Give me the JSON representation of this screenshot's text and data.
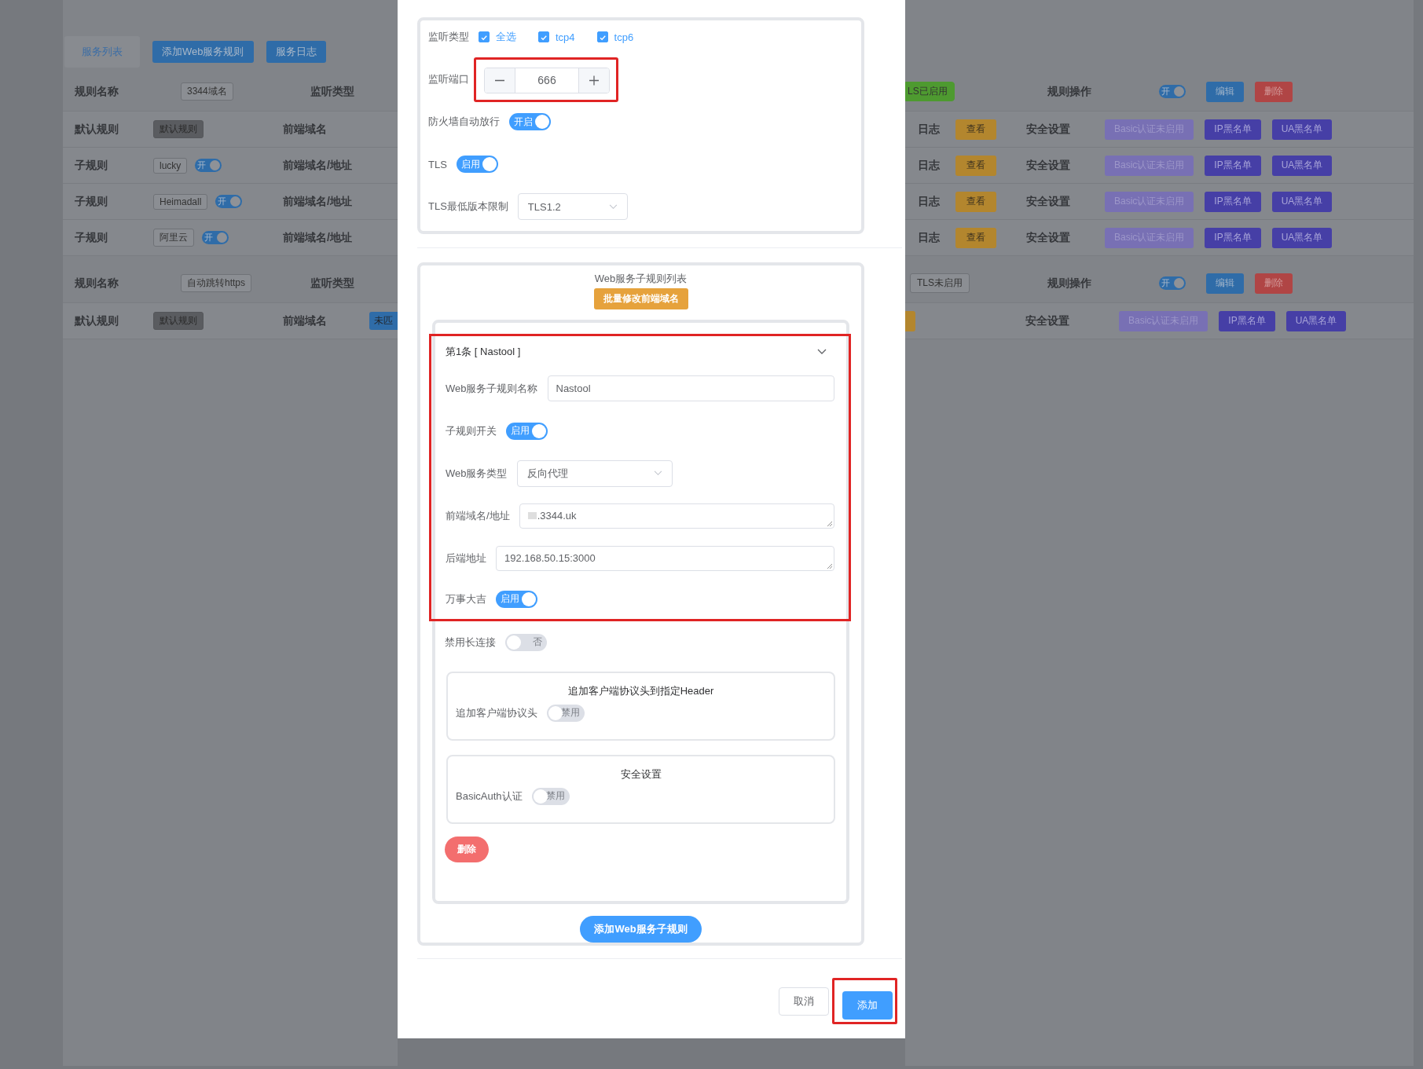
{
  "background": {
    "tabs": [
      {
        "label": "服务列表",
        "selected": true
      },
      {
        "label": "添加Web服务规则",
        "selected": false
      },
      {
        "label": "服务日志",
        "selected": false
      }
    ],
    "rules": [
      {
        "name_label": "规则名称",
        "name": "3344域名",
        "listen_label": "监听类型",
        "tls": {
          "text": "LS已启用",
          "enabled": true
        },
        "ops_label": "规则操作",
        "switch": {
          "text": "开",
          "on": true
        },
        "edit": "编辑",
        "delete": "删除",
        "subrules": [
          {
            "type": "默认规则",
            "tag": {
              "text": "默认规则",
              "kind": "default"
            },
            "domain_label": "前端域名",
            "log_label": "日志",
            "view": "查看",
            "security_label": "安全设置",
            "basic": "Basic认证未启用",
            "ip": "IP黑名单",
            "ua": "UA黑名单"
          },
          {
            "type": "子规则",
            "tag": {
              "text": "lucky",
              "kind": "name"
            },
            "switch": {
              "text": "开",
              "on": true
            },
            "domain_label": "前端域名/地址",
            "log_label": "日志",
            "view": "查看",
            "security_label": "安全设置",
            "basic": "Basic认证未启用",
            "ip": "IP黑名单",
            "ua": "UA黑名单"
          },
          {
            "type": "子规则",
            "tag": {
              "text": "Heimadall",
              "kind": "name"
            },
            "switch": {
              "text": "开",
              "on": true
            },
            "domain_label": "前端域名/地址",
            "log_label": "日志",
            "view": "查看",
            "security_label": "安全设置",
            "basic": "Basic认证未启用",
            "ip": "IP黑名单",
            "ua": "UA黑名单"
          },
          {
            "type": "子规则",
            "tag": {
              "text": "阿里云",
              "kind": "name"
            },
            "switch": {
              "text": "开",
              "on": true
            },
            "domain_label": "前端域名/地址",
            "log_label": "日志",
            "view": "查看",
            "security_label": "安全设置",
            "basic": "Basic认证未启用",
            "ip": "IP黑名单",
            "ua": "UA黑名单"
          }
        ]
      },
      {
        "name_label": "规则名称",
        "name": "自动跳转https",
        "listen_label": "监听类型",
        "tls": {
          "text": "TLS未启用",
          "enabled": false
        },
        "ops_label": "规则操作",
        "switch": {
          "text": "开",
          "on": true
        },
        "edit": "编辑",
        "delete": "删除",
        "subrules": [
          {
            "type": "默认规则",
            "tag": {
              "text": "默认规则",
              "kind": "default"
            },
            "domain_label": "前端域名",
            "match": "未匹",
            "view_cut": true,
            "security_label": "安全设置",
            "basic": "Basic认证未启用",
            "ip": "IP黑名单",
            "ua": "UA黑名单"
          }
        ]
      }
    ]
  },
  "dialog": {
    "listen": {
      "label": "监听类型",
      "options": [
        {
          "label": "全选",
          "checked": true
        },
        {
          "label": "tcp4",
          "checked": true
        },
        {
          "label": "tcp6",
          "checked": true
        }
      ]
    },
    "port": {
      "label": "监听端口",
      "value": "666",
      "highlighted": true
    },
    "firewall": {
      "label": "防火墙自动放行",
      "text": "开启",
      "on": true
    },
    "tls": {
      "label": "TLS",
      "text": "启用",
      "on": true
    },
    "tls_min": {
      "label": "TLS最低版本限制",
      "value": "TLS1.2"
    },
    "subrules": {
      "title": "Web服务子规则列表",
      "batch_button": "批量修改前端域名",
      "items": [
        {
          "header": "第1条 [ Nastool ]",
          "expanded": true,
          "highlighted": true,
          "fields": [
            {
              "kind": "input",
              "label": "Web服务子规则名称",
              "value": "Nastool"
            },
            {
              "kind": "switch",
              "label": "子规则开关",
              "text": "启用",
              "on": true
            },
            {
              "kind": "select",
              "label": "Web服务类型",
              "value": "反向代理"
            },
            {
              "kind": "textarea",
              "label": "前端域名/地址",
              "value": ".3344.uk",
              "redacted": true
            },
            {
              "kind": "textarea",
              "label": "后端地址",
              "value": "192.168.50.15:3000"
            },
            {
              "kind": "switch",
              "label": "万事大吉",
              "text": "启用",
              "on": true
            }
          ],
          "more_fields": [
            {
              "kind": "switch",
              "label": "禁用长连接",
              "text": "否",
              "on": false
            }
          ],
          "groups": [
            {
              "title": "追加客户端协议头到指定Header",
              "label": "追加客户端协议头",
              "text": "禁用",
              "on": false
            },
            {
              "title": "安全设置",
              "label": "BasicAuth认证",
              "text": "禁用",
              "on": false
            }
          ],
          "delete": "删除"
        }
      ],
      "add_button": "添加Web服务子规则"
    },
    "footer": {
      "cancel": "取消",
      "confirm": "添加",
      "confirm_highlighted": true
    }
  }
}
